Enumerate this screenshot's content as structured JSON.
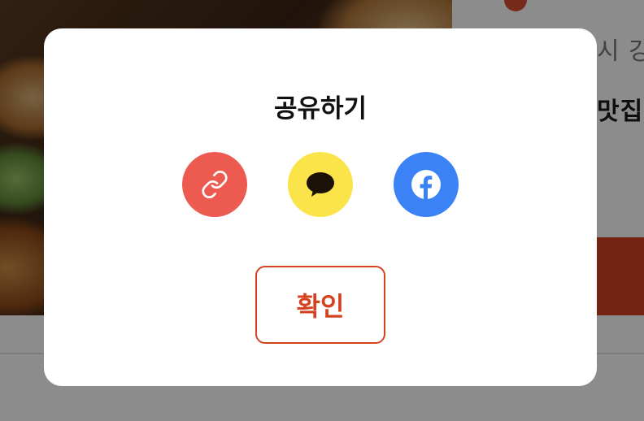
{
  "background": {
    "line1": "시 강",
    "line2": "맛집입"
  },
  "share_dialog": {
    "title": "공유하기",
    "options": [
      {
        "name": "copy-link",
        "icon": "link-icon",
        "color": "#ed5a4f"
      },
      {
        "name": "kakaotalk",
        "icon": "kakaotalk-icon",
        "color": "#fbe44a"
      },
      {
        "name": "facebook",
        "icon": "facebook-icon",
        "color": "#3b82f6"
      }
    ],
    "confirm_label": "확인",
    "accent_color": "#d4421f"
  }
}
